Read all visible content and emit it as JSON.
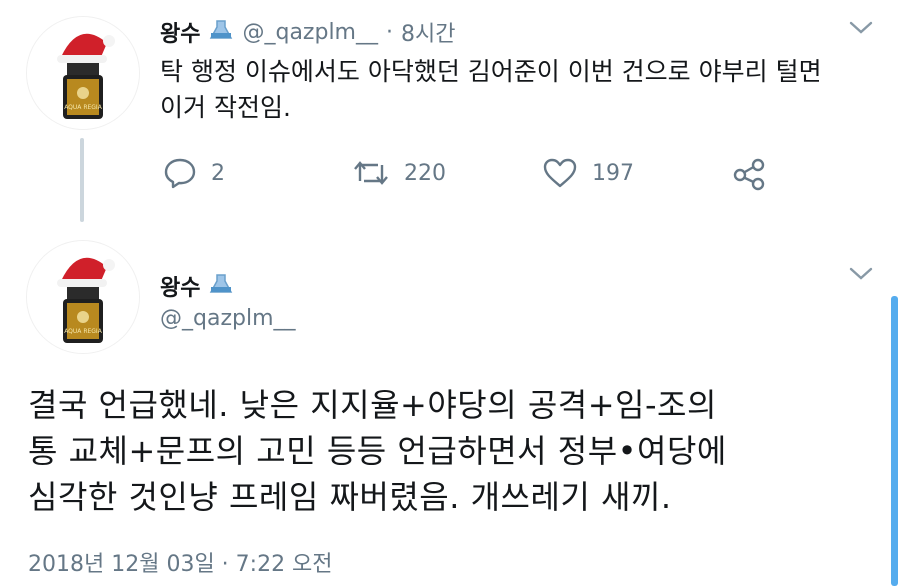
{
  "reply_tweet": {
    "name": "왕수",
    "handle": "@_qazplm__",
    "separator": "·",
    "time": "8시간",
    "text_line1": "탁 행정 이슈에서도 아닥했던 김어준이 이번 건으로 야부리 털면",
    "text_line2": "이거 작전임.",
    "replies": "2",
    "retweets": "220",
    "likes": "197"
  },
  "main_tweet": {
    "name": "왕수",
    "handle": "@_qazplm__",
    "text_line1": "결국 언급했네. 낮은 지지율+야당의 공격+임-조의",
    "text_line2": "통 교체+문프의 고민 등등 언급하면서 정부•여당에",
    "text_line3": "심각한 것인냥 프레임 짜버렸음. 개쓰레기 새끼.",
    "timestamp": "2018년 12월 03일 · 7:22 오전"
  },
  "avatar_label": "AQUA REGIA",
  "colors": {
    "accent": "#55acee",
    "muted": "#657786",
    "thread_line": "#ccd6dd",
    "text": "#14171a"
  },
  "icons": [
    "flask-icon",
    "reply-icon",
    "retweet-icon",
    "like-icon",
    "share-icon",
    "chevron-down-icon"
  ]
}
